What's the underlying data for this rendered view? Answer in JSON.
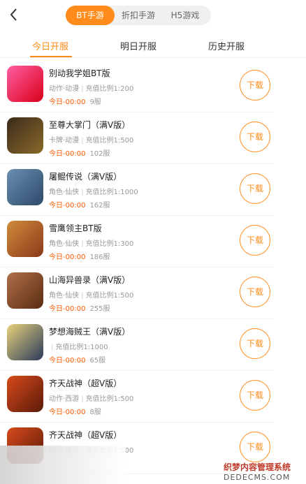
{
  "header": {
    "tabs": [
      {
        "label": "BT手游"
      },
      {
        "label": "折扣手游"
      },
      {
        "label": "H5游戏"
      }
    ]
  },
  "subtabs": [
    {
      "label": "今日开服"
    },
    {
      "label": "明日开服"
    },
    {
      "label": "历史开服"
    }
  ],
  "games": [
    {
      "title": "别动我学姐BT版",
      "tags": [
        "动作·动漫"
      ],
      "ratio": "充值比例1:200",
      "time": "今日-00:00",
      "server": "9服",
      "button": "下载"
    },
    {
      "title": "至尊大掌门（满V版）",
      "tags": [
        "卡牌·动漫"
      ],
      "ratio": "充值比例1:500",
      "time": "今日-00:00",
      "server": "102服",
      "button": "下载"
    },
    {
      "title": "屠鲲传说（满V版）",
      "tags": [
        "角色·仙侠"
      ],
      "ratio": "充值比例1:1000",
      "time": "今日-00:00",
      "server": "162服",
      "button": "下载"
    },
    {
      "title": "雪鹰领主BT版",
      "tags": [
        "角色·仙侠"
      ],
      "ratio": "充值比例1:300",
      "time": "今日-00:00",
      "server": "186服",
      "button": "下载"
    },
    {
      "title": "山海异兽录（满V版）",
      "tags": [
        "角色·仙侠"
      ],
      "ratio": "充值比例1:500",
      "time": "今日-00:00",
      "server": "255服",
      "button": "下载"
    },
    {
      "title": "梦想海贼王（满V版）",
      "tags": [
        ""
      ],
      "ratio": "充值比例1:1000",
      "time": "今日-00:00",
      "server": "65服",
      "button": "下载"
    },
    {
      "title": "齐天战神（超V版）",
      "tags": [
        "动作·西游"
      ],
      "ratio": "充值比例1:500",
      "time": "今日-00:00",
      "server": "8服",
      "button": "下载"
    },
    {
      "title": "齐天战神（超V版）",
      "tags": [
        "动作·西游"
      ],
      "ratio": "充值比例1:500",
      "time": "",
      "server": "",
      "button": "下载"
    }
  ],
  "watermark": {
    "line1": "织梦内容管理系统",
    "line2": "DEDECMS.COM"
  },
  "colors": {
    "accent": "#ff8c1a",
    "time": "#ff5a00"
  },
  "icons": {
    "back": "chevron-left-icon"
  }
}
